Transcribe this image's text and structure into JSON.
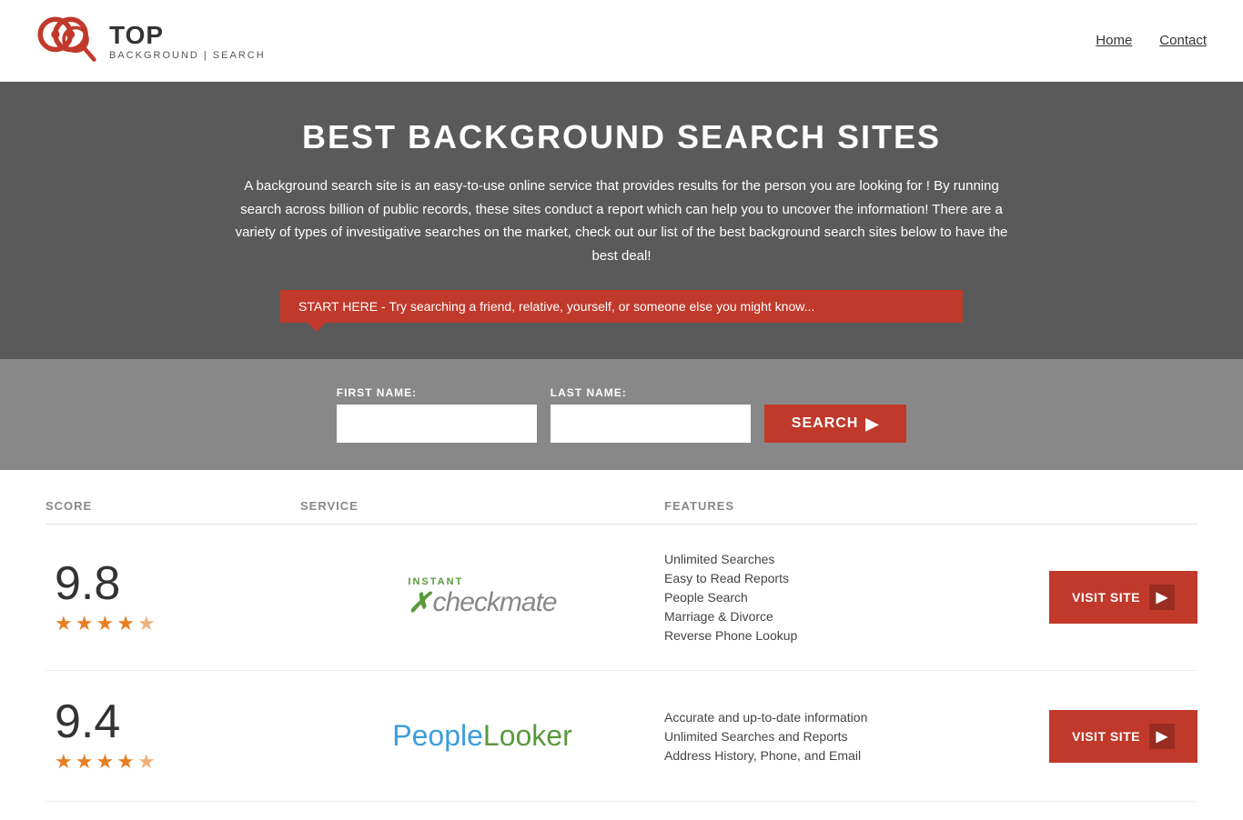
{
  "header": {
    "logo_top": "TOP",
    "logo_sub1": "BACKGROUND",
    "logo_sub2": "SEARCH",
    "nav": {
      "home": "Home",
      "contact": "Contact"
    }
  },
  "hero": {
    "title": "BEST BACKGROUND SEARCH SITES",
    "description": "A background search site is an easy-to-use online service that provides results  for the person you are looking for ! By  running  search across billion of public records, these sites conduct  a report which can help you to uncover the information! There are a variety of types of investigative searches on the market, check out our  list of the best background search sites below to have the best deal!",
    "callout": "START HERE - Try searching a friend, relative, yourself, or someone else you might know...",
    "form": {
      "first_name_label": "FIRST NAME:",
      "last_name_label": "LAST NAME:",
      "search_button": "SEARCH"
    }
  },
  "table": {
    "headers": {
      "score": "SCORE",
      "service": "SERVICE",
      "features": "FEATURES"
    },
    "rows": [
      {
        "score": "9.8",
        "stars": 4.5,
        "service_name": "Instant Checkmate",
        "features": [
          "Unlimited Searches",
          "Easy to Read Reports",
          "People Search",
          "Marriage & Divorce",
          "Reverse Phone Lookup"
        ],
        "visit_label": "VISIT SITE"
      },
      {
        "score": "9.4",
        "stars": 4.5,
        "service_name": "PeopleLooker",
        "features": [
          "Accurate and up-to-date information",
          "Unlimited Searches and Reports",
          "Address History, Phone, and Email"
        ],
        "visit_label": "VISIT SITE"
      }
    ]
  }
}
